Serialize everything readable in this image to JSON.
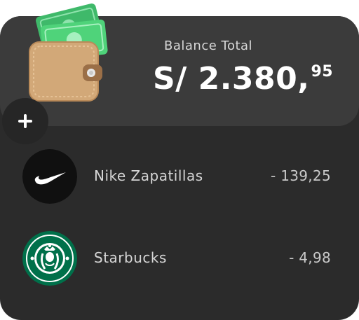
{
  "balance": {
    "label": "Balance Total",
    "amount_main": "S/ 2.380,",
    "amount_cents": "95"
  },
  "actions": {
    "add_icon": "plus-icon"
  },
  "transactions": [
    {
      "name": "Nike Zapatillas",
      "amount": "- 139,25",
      "logo": "nike-logo"
    },
    {
      "name": "Starbucks",
      "amount": "- 4,98",
      "logo": "starbucks-logo"
    }
  ],
  "colors": {
    "card_bg": "#2b2b2b",
    "panel_bg": "#3b3b3b",
    "starbucks_green": "#00704a",
    "wallet_tan": "#d2a878",
    "money_green": "#48c774"
  }
}
